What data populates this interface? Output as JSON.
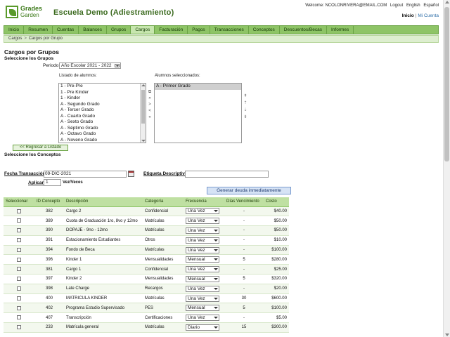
{
  "brand": {
    "logo_line1": "Grades",
    "logo_line2": "Garden",
    "school": "Escuela Demo (Adiestramiento)"
  },
  "top": {
    "welcome": "Welcome: NCOLONRIVERA@EMAIL.COM",
    "logout": "Logout",
    "english": "English",
    "espanol": "Español",
    "inicio": "Inicio",
    "sep": "|",
    "mi_cuenta": "Mi Cuenta"
  },
  "nav": [
    "Inicio",
    "Resumen",
    "Cuentas",
    "Balances",
    "Grupos",
    "Cargos",
    "Facturación",
    "Pagos",
    "Transacciones",
    "Conceptos",
    "Descuentos/Becas",
    "Informes"
  ],
  "breadcrumb": {
    "first": "Cargos",
    "arrow": ">",
    "second": "Cargos por Grupo"
  },
  "section": {
    "title": "Cargos por Grupos",
    "seleccione_grupos": "Seleccione los Grupos",
    "periodo_label": "Periodo",
    "periodo_value": "Año Escolar 2021 - 2022",
    "listado_label": "Listado de alumnos:",
    "seleccionados_label": "Alumnos seleccionados:",
    "listado": [
      "1 - Pre-Pre",
      "1 - Pre Kinder",
      "1 - Kinder",
      "A - Segundo Grado",
      "A - Tercer Grado",
      "A - Cuarto Grado",
      "A - Sexto Grado",
      "A - Séptimo Grado",
      "A - Octavo Grado",
      "A - Noveno Grado"
    ],
    "seleccionados": [
      "A - Primer Grado"
    ],
    "mover_buttons": [
      "⧉",
      "»",
      ">",
      "<",
      "«"
    ],
    "orden_buttons": [
      "⇞",
      "⇡",
      "⇣",
      "⇟"
    ],
    "regresar": "<< Regresar a Listado",
    "seleccione_conceptos": "Seleccione los Conceptos"
  },
  "form": {
    "fecha_label": "Fecha Transacción",
    "fecha_value": "09-DIC-2021",
    "etiqueta_label": "Etiqueta Descriptiva",
    "etiqueta_value": "",
    "aplicar_label": "Aplicar",
    "aplicar_value": "1",
    "vez_label": "Vez/Veces",
    "generar": "Generar deuda inmediatamente"
  },
  "table": {
    "headers": [
      "Seleccionar",
      "ID Concepto",
      "Descripción",
      "Categoría",
      "Frecuencia",
      "Días Vencimiento",
      "Costo"
    ],
    "rows": [
      {
        "id": "382",
        "desc": "Cargo 2",
        "cat": "Confidencial",
        "freq": "Una Vez",
        "dias": "-",
        "costo": "$40.00"
      },
      {
        "id": "389",
        "desc": "Cuota de Graduación 1ro, 8vo y 12mo",
        "cat": "Matrículas",
        "freq": "Una Vez",
        "dias": "-",
        "costo": "$50.00"
      },
      {
        "id": "390",
        "desc": "DOPAJE - 9no - 12mo",
        "cat": "Matrículas",
        "freq": "Una Vez",
        "dias": "-",
        "costo": "$50.00"
      },
      {
        "id": "391",
        "desc": "Estacionamiento Estudiantes",
        "cat": "Otros",
        "freq": "Una Vez",
        "dias": "-",
        "costo": "$10.00"
      },
      {
        "id": "394",
        "desc": "Fondo de Beca",
        "cat": "Matrículas",
        "freq": "Una Vez",
        "dias": "-",
        "costo": "$100.00"
      },
      {
        "id": "396",
        "desc": "Kinder 1",
        "cat": "Mensualidades",
        "freq": "Mensual",
        "dias": "5",
        "costo": "$280.00"
      },
      {
        "id": "381",
        "desc": "Cargo 1",
        "cat": "Confidencial",
        "freq": "Una Vez",
        "dias": "-",
        "costo": "$25.00"
      },
      {
        "id": "397",
        "desc": "Kinder 2",
        "cat": "Mensualidades",
        "freq": "Mensual",
        "dias": "5",
        "costo": "$320.00"
      },
      {
        "id": "398",
        "desc": "Late Charge",
        "cat": "Recargos",
        "freq": "Una Vez",
        "dias": "-",
        "costo": "$20.00"
      },
      {
        "id": "400",
        "desc": "MATRICULA KINDER",
        "cat": "Matrículas",
        "freq": "Una Vez",
        "dias": "30",
        "costo": "$600.00"
      },
      {
        "id": "402",
        "desc": "Programa Estudio Supervisado",
        "cat": "PES",
        "freq": "Mensual",
        "dias": "5",
        "costo": "$100.00"
      },
      {
        "id": "407",
        "desc": "Transcripción",
        "cat": "Certificaciones",
        "freq": "Una Vez",
        "dias": "-",
        "costo": "$5.00"
      },
      {
        "id": "233",
        "desc": "Matrícula general",
        "cat": "Matrículas",
        "freq": "Diario",
        "dias": "15",
        "costo": "$300.00"
      }
    ]
  }
}
